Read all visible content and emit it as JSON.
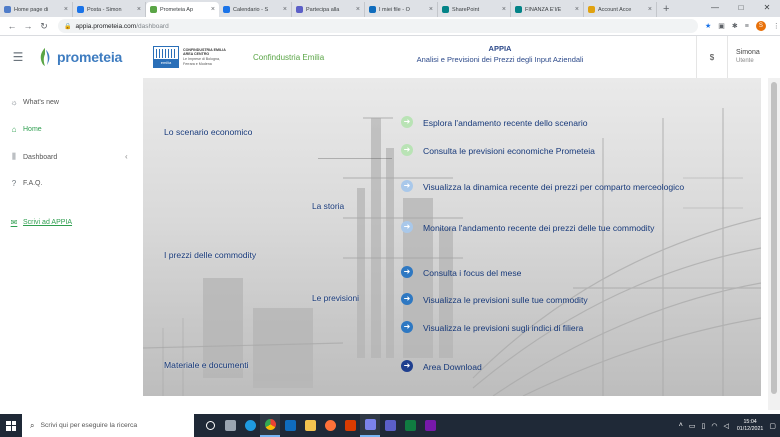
{
  "browser": {
    "tabs": [
      {
        "label": "Home page di",
        "color": "#4f7cc9",
        "active": false
      },
      {
        "label": "Posta - Simon",
        "color": "#1a73e8",
        "active": false
      },
      {
        "label": "Prometeia Ap",
        "color": "#5aa546",
        "active": true
      },
      {
        "label": "Calendario - S",
        "color": "#1a73e8",
        "active": false
      },
      {
        "label": "Partecipa alla",
        "color": "#5b5fc7",
        "active": false
      },
      {
        "label": "I miei file - O",
        "color": "#0f6cbd",
        "active": false
      },
      {
        "label": "SharePoint",
        "color": "#038387",
        "active": false
      },
      {
        "label": "FINANZA E'I/E",
        "color": "#038387",
        "active": false
      },
      {
        "label": "Account Acce",
        "color": "#e0a210",
        "active": false
      }
    ],
    "tab_close": "×",
    "new_tab": "+",
    "url_host": "appia.prometeia.com",
    "url_path": "/dashboard",
    "profile_initial": "S",
    "window_controls": [
      "—",
      "□",
      "✕"
    ]
  },
  "header": {
    "logo_text": "prometeia",
    "confindustria_lines": [
      "CONFINDUSTRIA EMILIA",
      "AREA CENTRO",
      "Le Imprese di Bologna,",
      "Ferrara e Modena"
    ],
    "confindustria_badge": "emilia",
    "confindustria_name": "Confindustria Emilia",
    "app_title": "APPIA",
    "app_subtitle": "Analisi e Previsioni dei Prezzi degli Input Aziendali",
    "currency_symbol": "$",
    "user_name": "Simona",
    "user_role": "Utente"
  },
  "sidebar": {
    "items": [
      {
        "label": "What's new",
        "icon": "lightbulb-icon",
        "glyph": "☼"
      },
      {
        "label": "Home",
        "icon": "home-icon",
        "glyph": "⌂"
      },
      {
        "label": "Dashboard",
        "icon": "bar-chart-icon",
        "glyph": "⫼"
      },
      {
        "label": "F.A.Q.",
        "icon": "question-icon",
        "glyph": "?"
      },
      {
        "label": "Scrivi ad APPIA",
        "icon": "mail-icon",
        "glyph": "✉"
      }
    ],
    "dashboard_chevron": "‹"
  },
  "main": {
    "categories": {
      "scenario": "Lo scenario economico",
      "prezzi": "I prezzi delle commodity",
      "materiale": "Materiale e documenti"
    },
    "subcategories": {
      "storia": "La storia",
      "previsioni": "Le previsioni"
    },
    "links": {
      "explore": "Esplora l'andamento recente dello scenario",
      "consult_forecast": "Consulta le previsioni economiche Prometeia",
      "price_dynamics": "Visualizza la dinamica recente dei prezzi per comparto merceologico",
      "monitor": "Monitora l'andamento recente dei prezzi delle tue commodity",
      "focus": "Consulta i focus del mese",
      "forecast_commodity": "Visualizza le previsioni sulle tue commodity",
      "forecast_indices": "Visualizza le previsioni sugli indici di filiera",
      "download": "Area Download"
    },
    "link_arrow": "➜"
  },
  "taskbar": {
    "search_placeholder": "Scrivi qui per eseguire la ricerca",
    "time": "15:04",
    "date": "01/12/2021"
  }
}
